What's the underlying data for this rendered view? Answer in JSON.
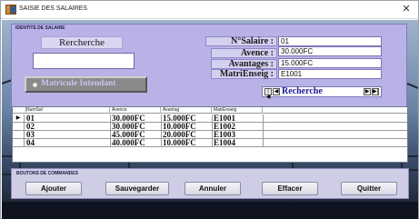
{
  "window": {
    "title": "SAISIE DES SALAIRES",
    "close_glyph": "✕"
  },
  "identity_panel": {
    "title": "IDENTITE DE SALAIRE",
    "search_button_label": "Rercherche",
    "search_input_value": "",
    "radio_label": "Matricule Intendant",
    "fields": {
      "nsalaire": {
        "label": "N°Salaire :",
        "value": "01"
      },
      "avence": {
        "label": "Avence :",
        "value": "30.000FC"
      },
      "avantages": {
        "label": "Avantages :",
        "value": "15.000FC"
      },
      "matrienseig": {
        "label": "MatriEnseig :",
        "value": "E1001"
      }
    },
    "navigator": {
      "first_glyph": "|◀",
      "prev_glyph": "◀",
      "label": "Recherche",
      "next_glyph": "▶",
      "last_glyph": "▶|"
    }
  },
  "grid": {
    "columns": [
      "NumSal",
      "Avence",
      "Avantag",
      "MatrEnseig"
    ],
    "current_row_glyph": "▶",
    "rows": [
      [
        "01",
        "30.000FC",
        "15.000FC",
        "E1001"
      ],
      [
        "02",
        "30.000FC",
        "10.000FC",
        "E1002"
      ],
      [
        "03",
        "45.000FC",
        "20.000FC",
        "E1003"
      ],
      [
        "04",
        "40.000FC",
        "10.000FC",
        "E1004"
      ]
    ]
  },
  "commands": {
    "title": "BOUTONS DE COMMANDES",
    "ajouter": "Ajouter",
    "sauvegarder": "Sauvegarder",
    "annuler": "Annuler",
    "effacer": "Effacer",
    "quitter": "Quitter"
  },
  "colors": {
    "panel": "#b9b2e6",
    "navigator_text": "#1c1a9e",
    "background_sky": "#8ea3bd"
  }
}
